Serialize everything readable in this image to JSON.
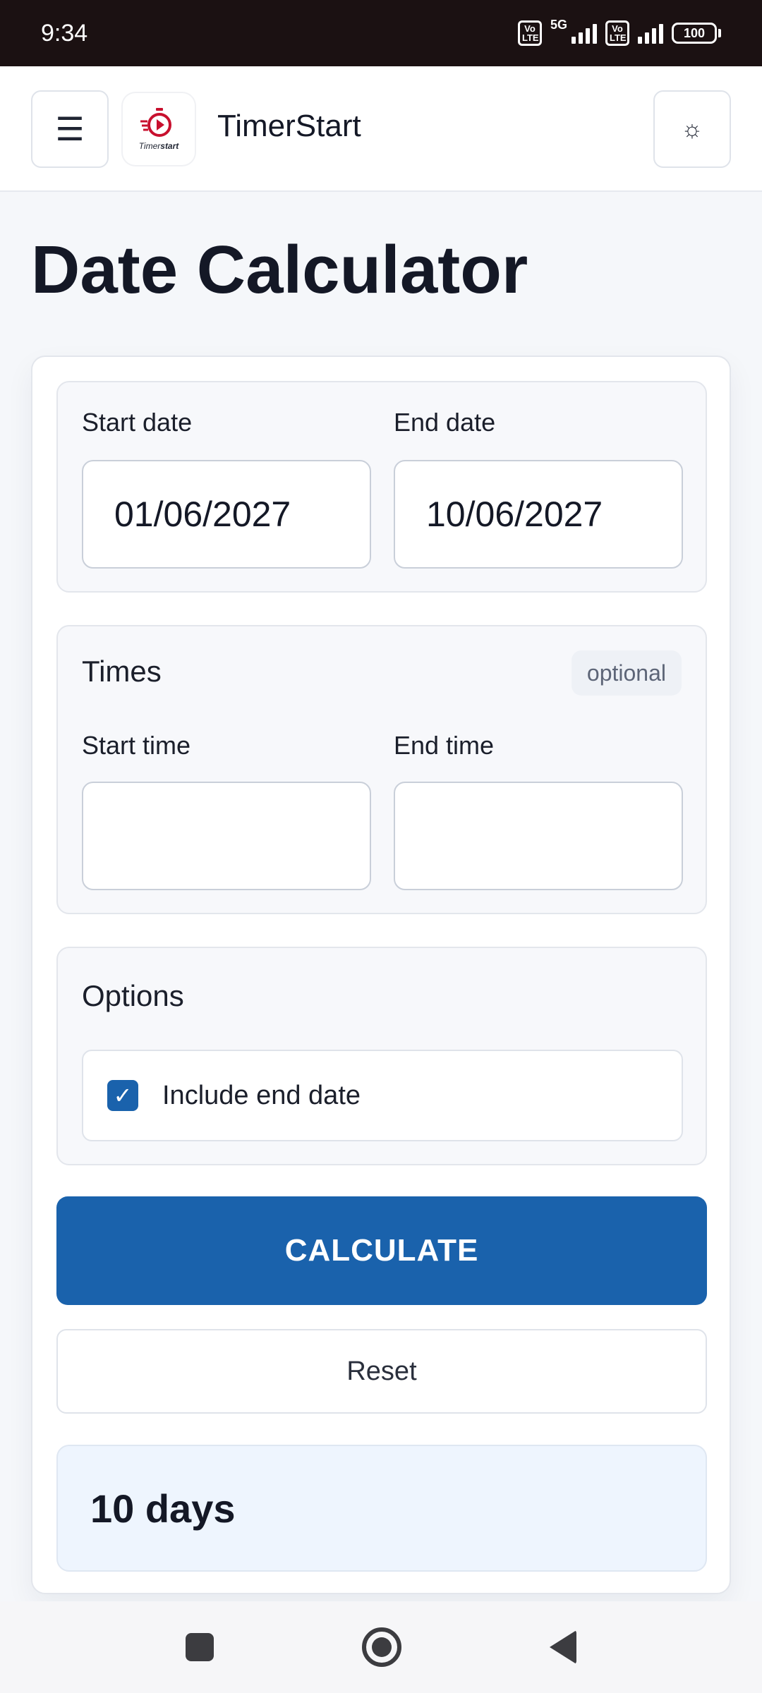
{
  "status_bar": {
    "time": "9:34",
    "volte_1": "Vo LTE",
    "network": "5G",
    "volte_2": "Vo LTE",
    "battery": "100"
  },
  "header": {
    "app_title": "TimerStart",
    "logo_text_a": "Timer",
    "logo_text_b": "start",
    "menu_icon": "☰",
    "theme_icon": "☼"
  },
  "page": {
    "title": "Date Calculator"
  },
  "dates": {
    "start_label": "Start date",
    "start_value": "01/06/2027",
    "end_label": "End date",
    "end_value": "10/06/2027"
  },
  "times": {
    "title": "Times",
    "badge": "optional",
    "start_label": "Start time",
    "start_value": "",
    "end_label": "End time",
    "end_value": ""
  },
  "options": {
    "title": "Options",
    "include_end_date_label": "Include end date",
    "include_end_date_checked": true,
    "check_glyph": "✓"
  },
  "actions": {
    "calculate_label": "CALCULATE",
    "reset_label": "Reset"
  },
  "result": {
    "text": "10 days"
  },
  "colors": {
    "accent": "#1a62ac",
    "logo_red": "#c8102e"
  }
}
